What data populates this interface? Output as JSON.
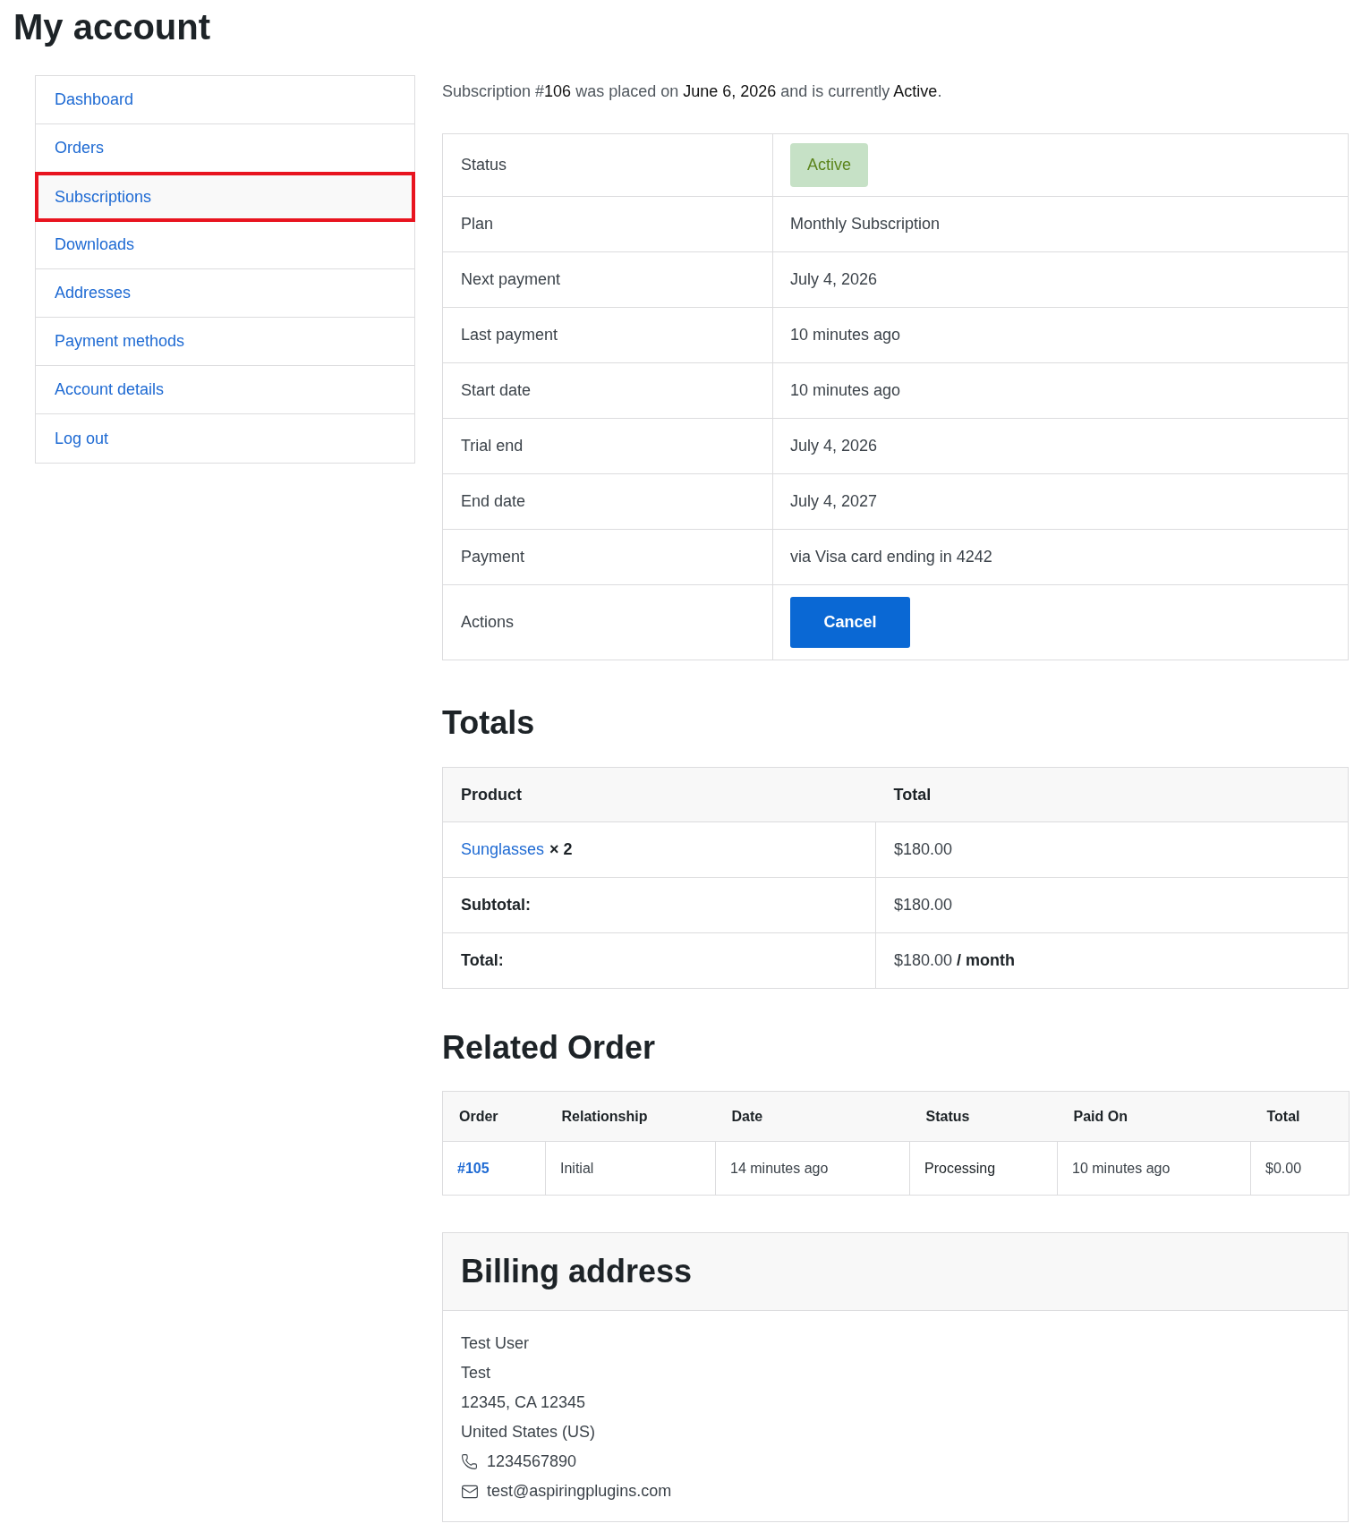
{
  "page": {
    "title": "My account"
  },
  "sidebar": {
    "items": [
      {
        "label": "Dashboard",
        "selected": false
      },
      {
        "label": "Orders",
        "selected": false
      },
      {
        "label": "Subscriptions",
        "selected": true
      },
      {
        "label": "Downloads",
        "selected": false
      },
      {
        "label": "Addresses",
        "selected": false
      },
      {
        "label": "Payment methods",
        "selected": false
      },
      {
        "label": "Account details",
        "selected": false
      },
      {
        "label": "Log out",
        "selected": false
      }
    ]
  },
  "subscription": {
    "intro": [
      {
        "text": "Subscription #",
        "emphasis": false
      },
      {
        "text": "106",
        "emphasis": true
      },
      {
        "text": " was placed on ",
        "emphasis": false
      },
      {
        "text": "June 6, 2026",
        "emphasis": true
      },
      {
        "text": " and is currently ",
        "emphasis": false
      },
      {
        "text": "Active",
        "emphasis": true
      },
      {
        "text": ".",
        "emphasis": false
      }
    ],
    "rows": [
      {
        "label": "Status",
        "kind": "badge",
        "value": "Active"
      },
      {
        "label": "Plan",
        "kind": "text",
        "value": "Monthly Subscription"
      },
      {
        "label": "Next payment",
        "kind": "text",
        "value": "July 4, 2026"
      },
      {
        "label": "Last payment",
        "kind": "text",
        "value": "10 minutes ago"
      },
      {
        "label": "Start date",
        "kind": "text",
        "value": "10 minutes ago"
      },
      {
        "label": "Trial end",
        "kind": "text",
        "value": "July 4, 2026"
      },
      {
        "label": "End date",
        "kind": "text",
        "value": "July 4, 2027"
      },
      {
        "label": "Payment",
        "kind": "text",
        "value": "via Visa card ending in 4242"
      },
      {
        "label": "Actions",
        "kind": "button",
        "value": "Cancel"
      }
    ]
  },
  "totals": {
    "heading": "Totals",
    "columns": [
      "Product",
      "Total"
    ],
    "item": {
      "product": "Sunglasses",
      "quantity": "× 2",
      "total": "$180.00"
    },
    "rows": [
      {
        "label": "Subtotal:",
        "value": "$180.00"
      },
      {
        "label": "Total:",
        "value": "$180.00 **/ month**"
      }
    ]
  },
  "related_order": {
    "heading": "Related Order",
    "columns": [
      "Order",
      "Relationship",
      "Date",
      "Status",
      "Paid On",
      "Total"
    ],
    "rows": [
      {
        "order": "#105",
        "relationship": "Initial",
        "date": "14 minutes ago",
        "status": "Processing",
        "paid_on": "10 minutes ago",
        "total": "$0.00"
      }
    ]
  },
  "billing_address": {
    "heading": "Billing address",
    "lines": [
      "Test User",
      "Test",
      "12345, CA 12345",
      "United States (US)"
    ],
    "phone": "1234567890",
    "email": "test@aspiringplugins.com"
  }
}
